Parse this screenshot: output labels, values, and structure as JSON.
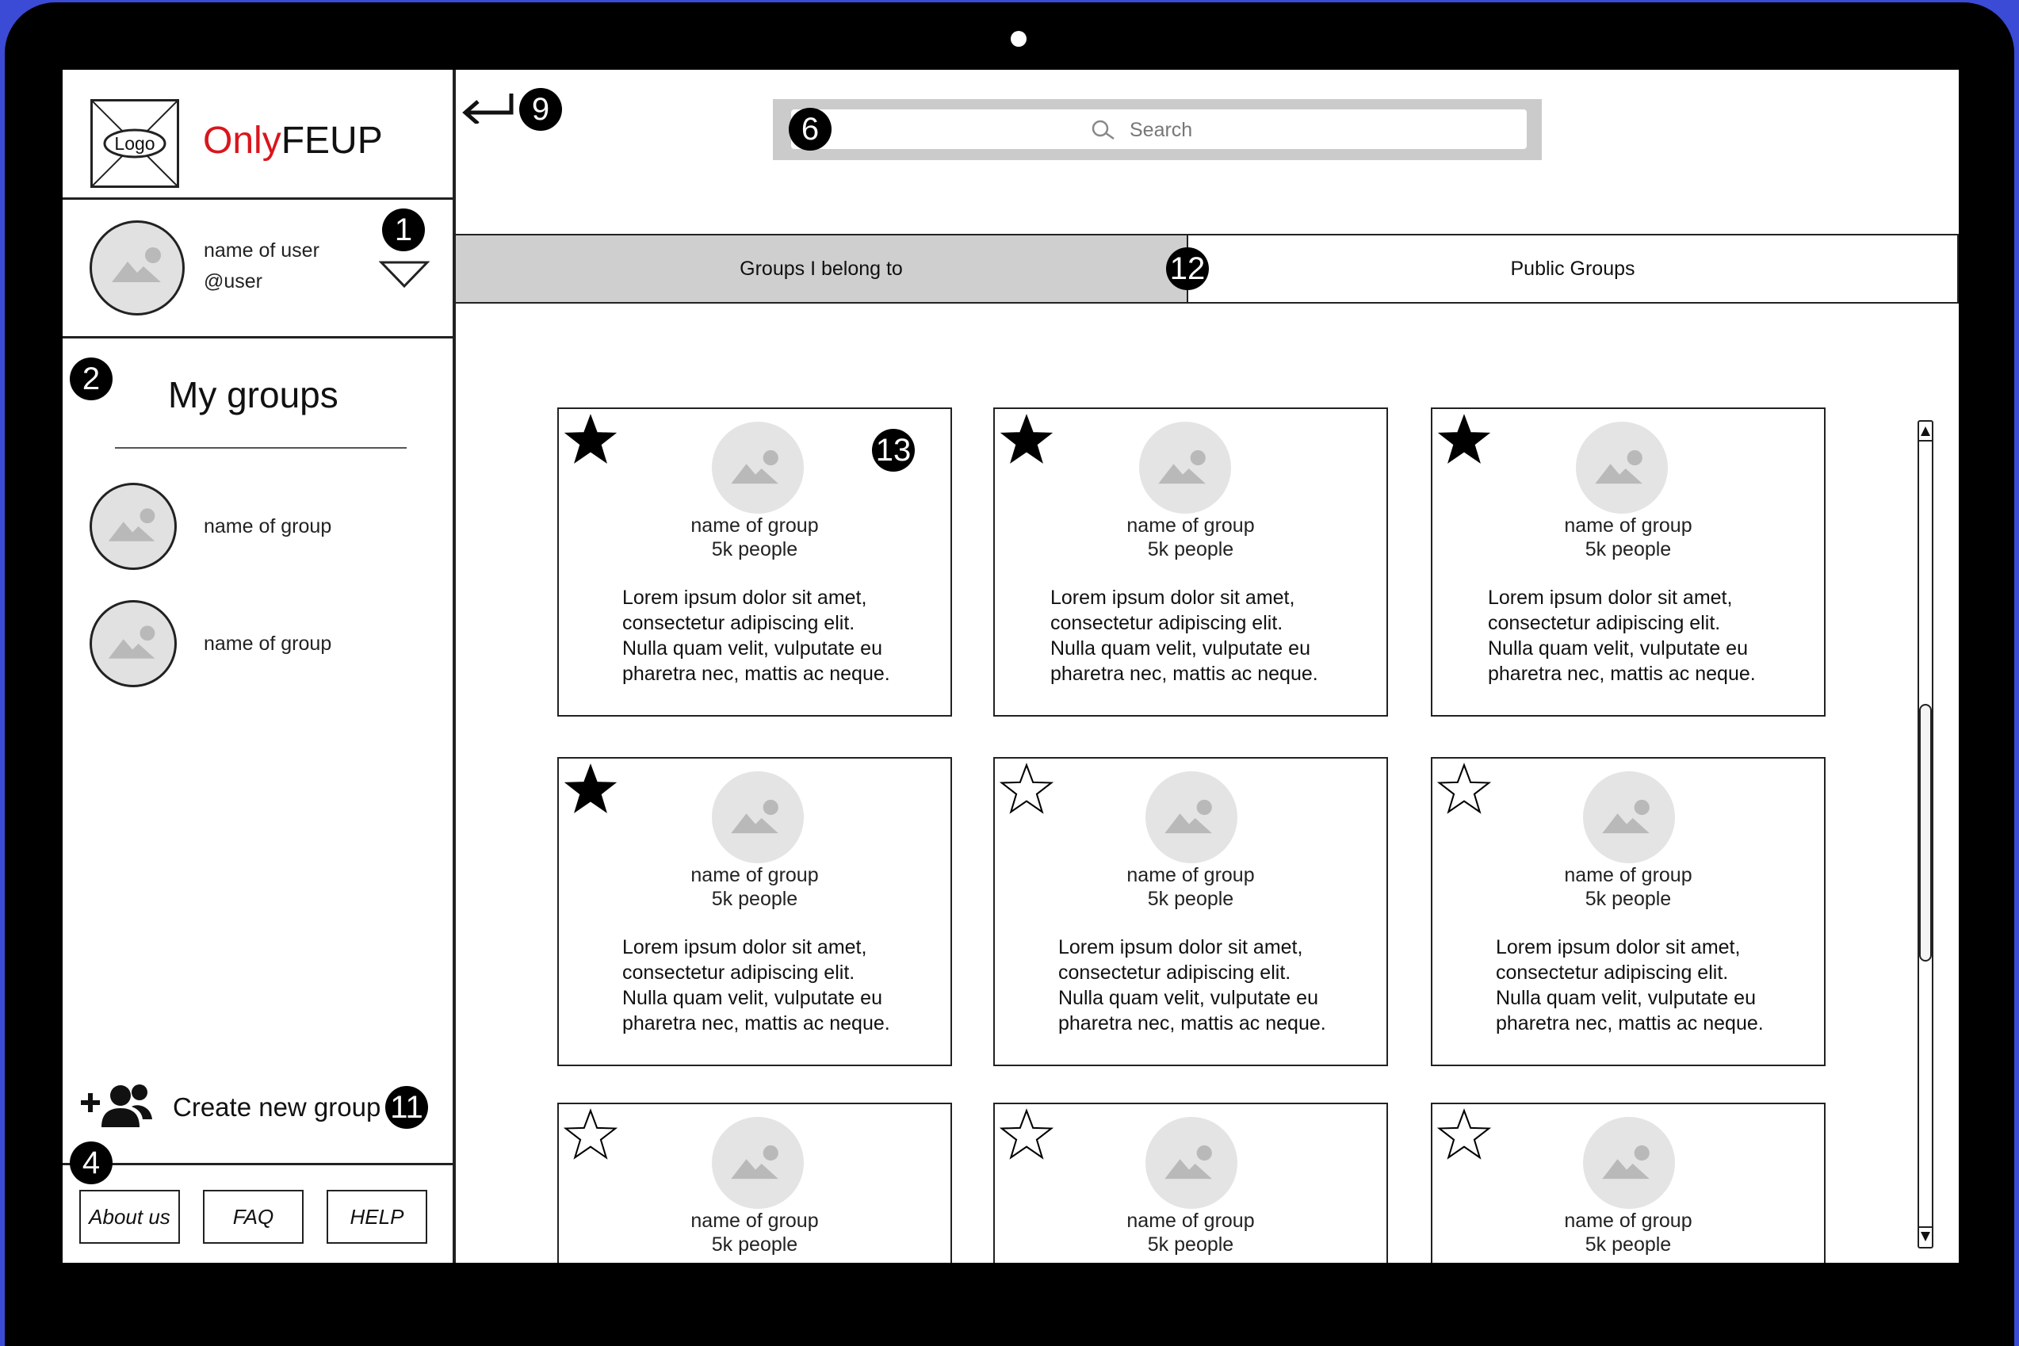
{
  "brand": {
    "logo_label": "Logo",
    "name_part1": "Only",
    "name_part2": "FEUP"
  },
  "user": {
    "name": "name of user",
    "handle": "@user"
  },
  "sidebar": {
    "title": "My groups",
    "groups": [
      {
        "label": "name of group"
      },
      {
        "label": "name of group"
      }
    ],
    "create_label": "Create new group",
    "footer": {
      "about": "About us",
      "faq": "FAQ",
      "help": "HELP"
    }
  },
  "search": {
    "placeholder": "Search"
  },
  "tabs": [
    {
      "label": "Groups I belong to",
      "active": true
    },
    {
      "label": "Public Groups",
      "active": false
    }
  ],
  "cards": [
    {
      "name": "name of group",
      "members": "5k people",
      "starred": true,
      "desc": [
        "Lorem ipsum dolor sit amet,",
        "consectetur adipiscing elit.",
        "Nulla quam velit, vulputate eu",
        "pharetra nec, mattis ac neque."
      ]
    },
    {
      "name": "name of group",
      "members": "5k people",
      "starred": true,
      "desc": [
        "Lorem ipsum dolor sit amet,",
        "consectetur adipiscing elit.",
        "Nulla quam velit, vulputate eu",
        "pharetra nec, mattis ac neque."
      ]
    },
    {
      "name": "name of group",
      "members": "5k people",
      "starred": true,
      "desc": [
        "Lorem ipsum dolor sit amet,",
        "consectetur adipiscing elit.",
        "Nulla quam velit, vulputate eu",
        "pharetra nec, mattis ac neque."
      ]
    },
    {
      "name": "name of group",
      "members": "5k people",
      "starred": true,
      "desc": [
        "Lorem ipsum dolor sit amet,",
        "consectetur adipiscing elit.",
        "Nulla quam velit, vulputate eu",
        "pharetra nec, mattis ac neque."
      ]
    },
    {
      "name": "name of group",
      "members": "5k people",
      "starred": false,
      "desc": [
        "Lorem ipsum dolor sit amet,",
        "consectetur adipiscing elit.",
        "Nulla quam velit, vulputate eu",
        "pharetra nec, mattis ac neque."
      ]
    },
    {
      "name": "name of group",
      "members": "5k people",
      "starred": false,
      "desc": [
        "Lorem ipsum dolor sit amet,",
        "consectetur adipiscing elit.",
        "Nulla quam velit, vulputate eu",
        "pharetra nec, mattis ac neque."
      ]
    },
    {
      "name": "name of group",
      "members": "5k people",
      "starred": false
    },
    {
      "name": "name of group",
      "members": "5k people",
      "starred": false
    },
    {
      "name": "name of group",
      "members": "5k people",
      "starred": false
    }
  ],
  "annotations": {
    "a1": "1",
    "a2": "2",
    "a4": "4",
    "a6": "6",
    "a9": "9",
    "a11": "11",
    "a12": "12",
    "a13": "13"
  },
  "colors": {
    "brand_red": "#d9161d",
    "active_tab": "#cfcfcf",
    "search_frame": "#cbcbcb",
    "device": "#000000"
  }
}
